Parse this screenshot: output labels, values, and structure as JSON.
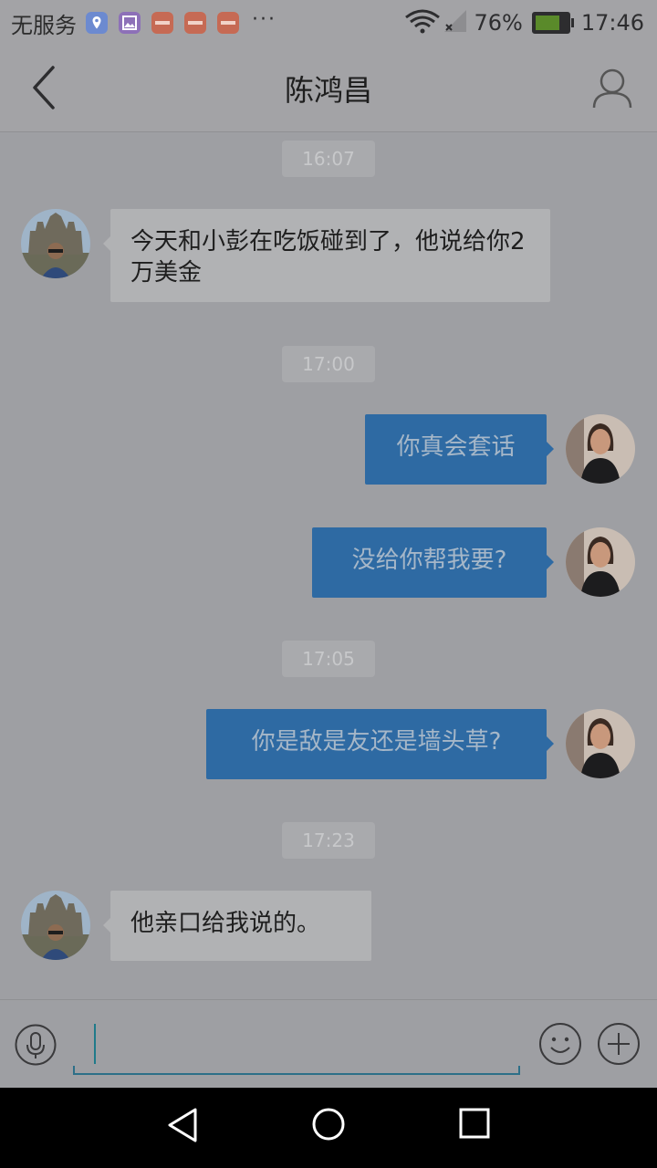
{
  "status_bar": {
    "carrier": "无服务",
    "notification_icons": [
      "map-icon",
      "gallery-icon",
      "news-app-icon",
      "news-app-icon",
      "news-app-icon"
    ],
    "more": "···",
    "battery_percent": "76%",
    "battery_level": 0.76,
    "time": "17:46"
  },
  "header": {
    "title": "陈鸿昌"
  },
  "messages": [
    {
      "type": "time",
      "text": "16:07"
    },
    {
      "type": "incoming",
      "text": "今天和小彭在吃饭碰到了，他说给你2万美金"
    },
    {
      "type": "time",
      "text": "17:00"
    },
    {
      "type": "outgoing",
      "text": "你真会套话"
    },
    {
      "type": "outgoing",
      "text": "没给你帮我要?"
    },
    {
      "type": "time",
      "text": "17:05"
    },
    {
      "type": "outgoing",
      "text": "你是敌是友还是墙头草?"
    },
    {
      "type": "time",
      "text": "17:23"
    },
    {
      "type": "incoming",
      "text": "他亲口给我说的。"
    }
  ],
  "composer": {
    "input_value": "",
    "placeholder": ""
  },
  "colors": {
    "outgoing_bubble": "#2e6aa3",
    "incoming_bubble": "#b1b2b4",
    "background": "#9e9fa3"
  }
}
